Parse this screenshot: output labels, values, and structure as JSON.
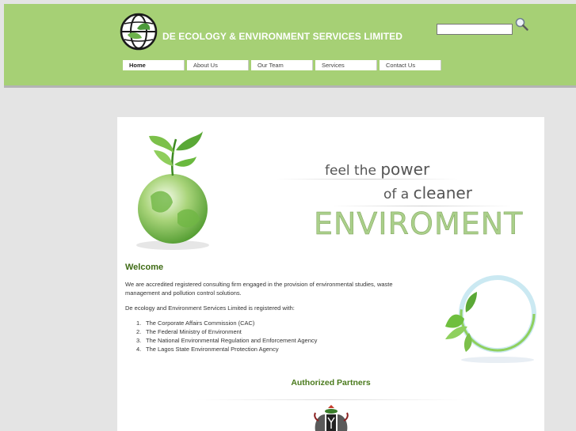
{
  "header": {
    "site_title": "DE ECOLOGY & ENVIRONMENT SERVICES LIMITED",
    "search_placeholder": "",
    "nav": [
      {
        "label": "Home",
        "active": true
      },
      {
        "label": "About Us",
        "active": false
      },
      {
        "label": "Our Team",
        "active": false
      },
      {
        "label": "Services",
        "active": false
      },
      {
        "label": "Contact Us",
        "active": false
      }
    ]
  },
  "banner": {
    "line1_a": "feel the ",
    "line1_b": "power",
    "line2_a": "of a ",
    "line2_b": "cleaner",
    "line3": "ENVIROMENT"
  },
  "main": {
    "welcome_title": "Welcome",
    "intro": "We are accredited registered consulting firm engaged in the provision of environmental studies, waste management and pollution control solutions.",
    "registered_with": "De ecology and Environment Services Limited is registered with:",
    "registrations": [
      "The Corporate Affairs Commission (CAC)",
      "The Federal Ministry of Environment",
      "The National Environmental Regulation and Enforcement Agency",
      "The Lagos State Environmental Protection Agency"
    ],
    "partners_title": "Authorized Partners"
  },
  "icons": {
    "logo": "globe-logo-icon",
    "search": "magnifier-icon",
    "banner": "green-globe-plant-icon",
    "ring": "leaf-ring-icon",
    "partner": "nigeria-coat-of-arms-icon"
  },
  "colors": {
    "header_bg": "#a6d075",
    "heading_green": "#3f6b15",
    "page_bg": "#e4e4e4"
  }
}
